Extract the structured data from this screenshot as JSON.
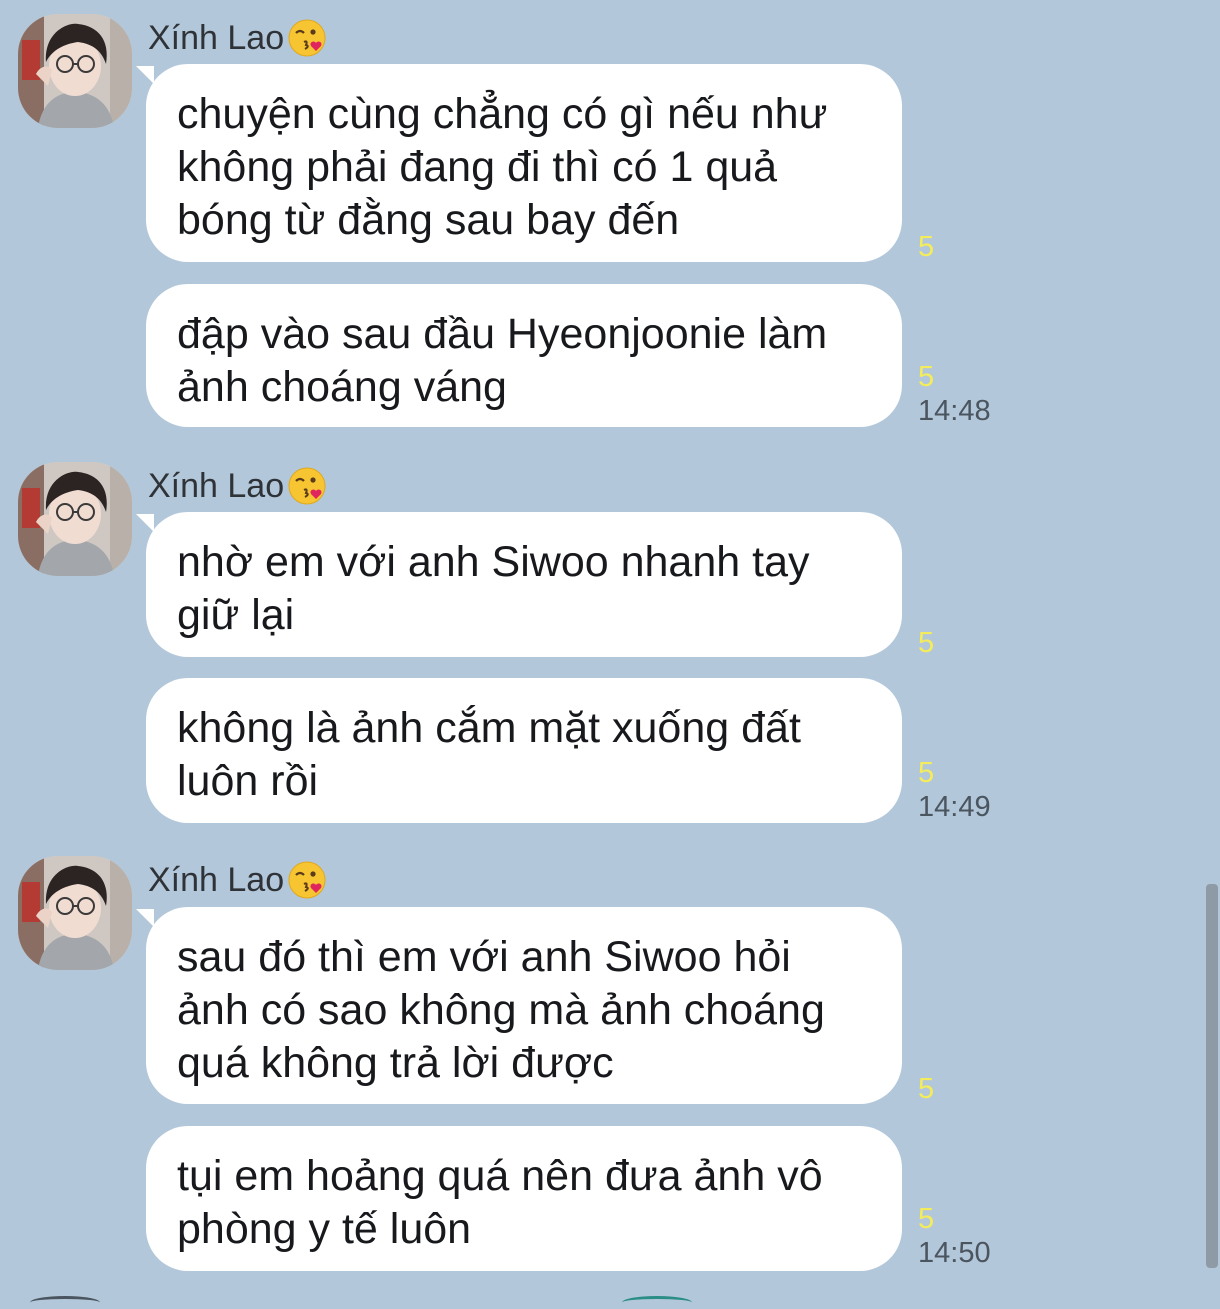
{
  "messages": [
    {
      "sender": "Xính Lao",
      "sender_emoji": "kissing-heart-emoji",
      "bubbles": [
        {
          "text": "chuyện cùng chẳng có gì nếu như\nkhông phải đang đi thì có 1 quả\nbóng từ đằng sau bay đến",
          "unread": "5"
        },
        {
          "text": "đập vào sau đầu Hyeonjoonie làm\nảnh choáng váng",
          "unread": "5",
          "time": "14:48"
        }
      ]
    },
    {
      "sender": "Xính Lao",
      "sender_emoji": "kissing-heart-emoji",
      "bubbles": [
        {
          "text": "nhờ em với anh Siwoo nhanh tay\ngiữ lại",
          "unread": "5"
        },
        {
          "text": "không là ảnh cắm mặt xuống đất\nluôn rồi",
          "unread": "5",
          "time": "14:49"
        }
      ]
    },
    {
      "sender": "Xính Lao",
      "sender_emoji": "kissing-heart-emoji",
      "bubbles": [
        {
          "text": "sau đó thì em với anh Siwoo hỏi\nảnh có sao không mà ảnh choáng\nquá không trả lời được",
          "unread": "5"
        },
        {
          "text": "tụi em hoảng quá nên đưa ảnh vô\nphòng y tế luôn",
          "unread": "5",
          "time": "14:50"
        }
      ]
    }
  ],
  "colors": {
    "background": "#b2c7d9",
    "bubble": "#ffffff",
    "unread": "#f4ec5b",
    "time": "#4b5560"
  }
}
